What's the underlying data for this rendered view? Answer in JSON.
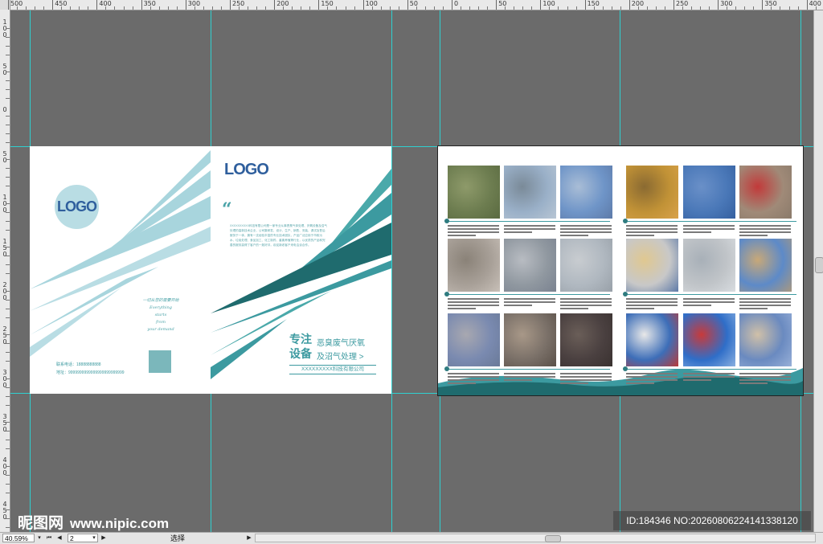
{
  "rulers": {
    "top_labels": [
      "500",
      "450",
      "400",
      "350",
      "300",
      "250",
      "200",
      "150",
      "100",
      "50",
      "0",
      "50",
      "100",
      "150",
      "200",
      "250",
      "300",
      "350",
      "400"
    ],
    "left_labels": [
      "1\n0\n0",
      "5\n0",
      "0",
      "5\n0",
      "1\n0\n0",
      "1\n5\n0",
      "2\n0\n0",
      "2\n5\n0",
      "3\n0\n0",
      "3\n5\n0",
      "4\n0\n0",
      "4\n5\n0"
    ]
  },
  "cover": {
    "logo_circle_text": "LOGO",
    "slogan_lines": [
      "一切从您的需要开始",
      "Everything",
      "starts",
      "from",
      "your demand"
    ],
    "phone_line": "联系电话：18888888888",
    "address_line": "地址：9999999999999999999999999",
    "logo_text": "LOGO",
    "quote_mark": "“",
    "intro_text": "XXXXXXXXXX科技有限公司是一家专业从事恶臭气体处理、厌氧设备及沼气处理的高新技术企业，公司集研发、设计、生产、销售、安装、调试及售后服务于一体，拥有一支经验丰富的专业技术团队，产品广泛应用于市政污水、垃圾处理、食品加工、化工制药、畜禽养殖等行业，以优质的产品和完善的服务赢得了客户的一致好评，欢迎新老客户来电洽谈合作。",
    "headline_left_1": "专注",
    "headline_left_2": "设备",
    "headline_right_1": "恶臭废气厌氧",
    "headline_right_2": "及沼气处理 >",
    "company": "XXXXXXXXX科技有限公司"
  },
  "colors": {
    "teal_dark": "#1f6b6e",
    "teal": "#3c9aa0",
    "teal_light": "#b9dde4",
    "guide": "#2fd0d0"
  },
  "status_bar": {
    "zoom": "40.59%",
    "page": "2",
    "mode": "选择"
  },
  "watermark": {
    "site_name": "昵图网",
    "site_url": "www.nipic.com",
    "id_text": "ID:184346 NO:20260806224141338120"
  }
}
